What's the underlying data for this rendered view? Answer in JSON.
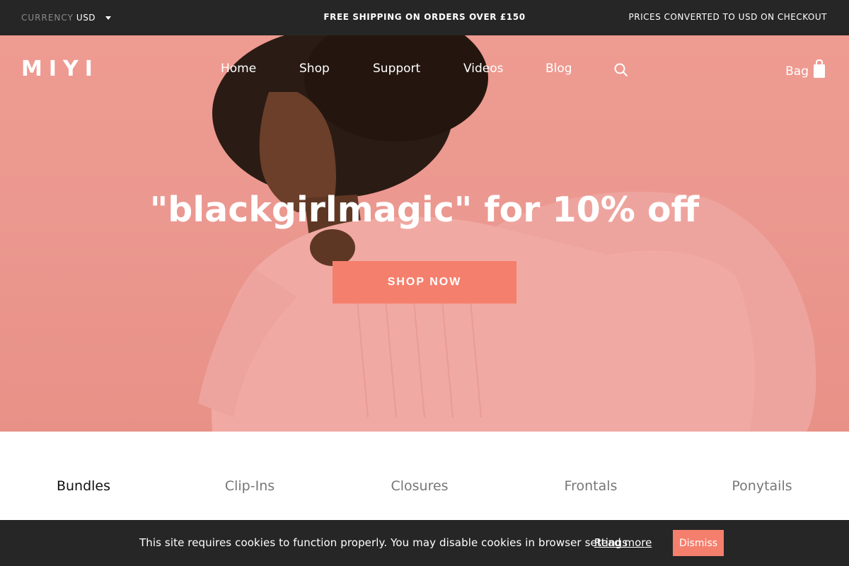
{
  "topbar": {
    "currency_label": "Currency",
    "currency_value": "USD",
    "promo": "FREE SHIPPING ON ORDERS OVER £150",
    "converted_note": "PRICES CONVERTED TO USD ON CHECKOUT"
  },
  "header": {
    "logo": "MIYI",
    "nav": [
      "Home",
      "Shop",
      "Support",
      "Videos",
      "Blog"
    ],
    "search_icon": "search-icon",
    "bag_label": "Bag",
    "bag_icon": "shopping-bag-icon"
  },
  "hero": {
    "title": "\"blackgirlmagic\" for 10% off",
    "cta": "SHOP NOW",
    "cta_color": "#f57f6d",
    "background_color": "#ee9b91"
  },
  "categories": {
    "tabs": [
      "Bundles",
      "Clip-Ins",
      "Closures",
      "Frontals",
      "Ponytails"
    ],
    "active": "Bundles"
  },
  "cookie": {
    "message": "This site requires cookies to function properly. You may disable cookies in browser settings",
    "read_more": "Read more",
    "dismiss": "Dismiss"
  }
}
